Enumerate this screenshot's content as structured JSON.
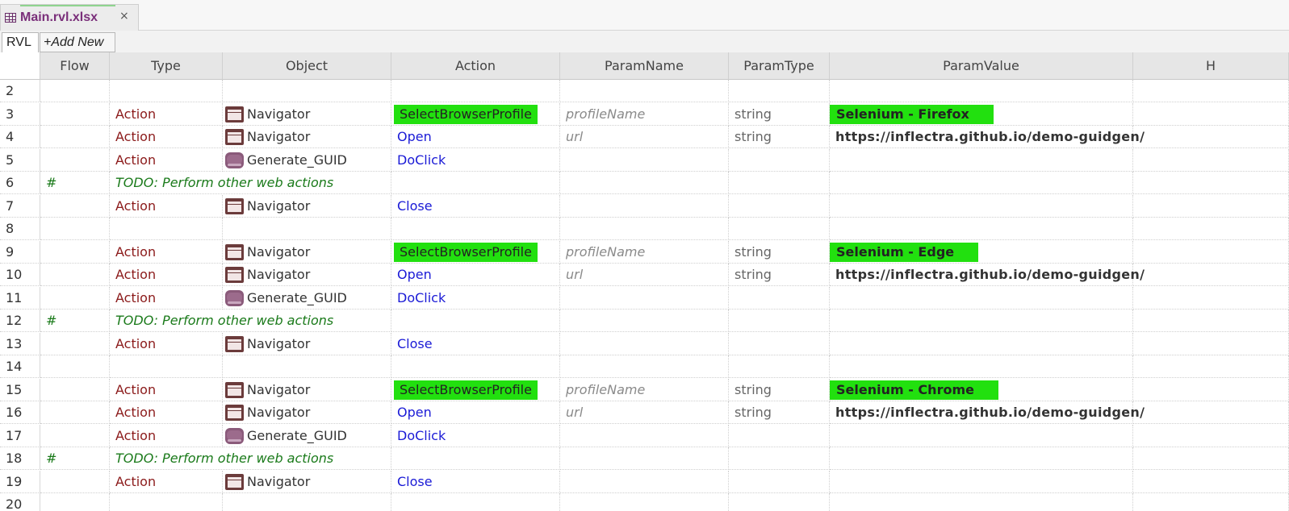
{
  "file_tab": {
    "name": "Main.rvl.xlsx",
    "close": "×"
  },
  "sheet_tabs": {
    "active": "RVL",
    "add": "+Add New"
  },
  "columns": [
    "Flow",
    "Type",
    "Object",
    "Action",
    "ParamName",
    "ParamType",
    "ParamValue",
    "H"
  ],
  "rows": [
    {
      "num": "2"
    },
    {
      "num": "3",
      "type": "Action",
      "object": "Navigator",
      "icon": "window-icon",
      "action": "SelectBrowserProfile",
      "action_highlight": true,
      "param_name": "profileName",
      "param_type": "string",
      "param_value": "Selenium - Firefox",
      "value_highlight": true
    },
    {
      "num": "4",
      "type": "Action",
      "object": "Navigator",
      "icon": "window-icon",
      "action": "Open",
      "param_name": "url",
      "param_type": "string",
      "param_value": "https://inflectra.github.io/demo-guidgen/"
    },
    {
      "num": "5",
      "type": "Action",
      "object": "Generate_GUID",
      "icon": "button-icon",
      "action": "DoClick"
    },
    {
      "num": "6",
      "flow": "#",
      "comment": "TODO: Perform other web actions"
    },
    {
      "num": "7",
      "type": "Action",
      "object": "Navigator",
      "icon": "window-icon",
      "action": "Close"
    },
    {
      "num": "8"
    },
    {
      "num": "9",
      "type": "Action",
      "object": "Navigator",
      "icon": "window-icon",
      "action": "SelectBrowserProfile",
      "action_highlight": true,
      "param_name": "profileName",
      "param_type": "string",
      "param_value": "Selenium - Edge",
      "value_highlight": true
    },
    {
      "num": "10",
      "type": "Action",
      "object": "Navigator",
      "icon": "window-icon",
      "action": "Open",
      "param_name": "url",
      "param_type": "string",
      "param_value": "https://inflectra.github.io/demo-guidgen/"
    },
    {
      "num": "11",
      "type": "Action",
      "object": "Generate_GUID",
      "icon": "button-icon",
      "action": "DoClick"
    },
    {
      "num": "12",
      "flow": "#",
      "comment": "TODO: Perform other web actions"
    },
    {
      "num": "13",
      "type": "Action",
      "object": "Navigator",
      "icon": "window-icon",
      "action": "Close"
    },
    {
      "num": "14"
    },
    {
      "num": "15",
      "type": "Action",
      "object": "Navigator",
      "icon": "window-icon",
      "action": "SelectBrowserProfile",
      "action_highlight": true,
      "param_name": "profileName",
      "param_type": "string",
      "param_value": "Selenium - Chrome",
      "value_highlight": true
    },
    {
      "num": "16",
      "type": "Action",
      "object": "Navigator",
      "icon": "window-icon",
      "action": "Open",
      "param_name": "url",
      "param_type": "string",
      "param_value": "https://inflectra.github.io/demo-guidgen/"
    },
    {
      "num": "17",
      "type": "Action",
      "object": "Generate_GUID",
      "icon": "button-icon",
      "action": "DoClick"
    },
    {
      "num": "18",
      "flow": "#",
      "comment": "TODO: Perform other web actions"
    },
    {
      "num": "19",
      "type": "Action",
      "object": "Navigator",
      "icon": "window-icon",
      "action": "Close"
    },
    {
      "num": "20"
    }
  ],
  "colors": {
    "highlight": "#22e00f",
    "type_red": "#8b1a1a",
    "action_blue": "#1a1ad6",
    "comment_green": "#1a7a1a"
  }
}
